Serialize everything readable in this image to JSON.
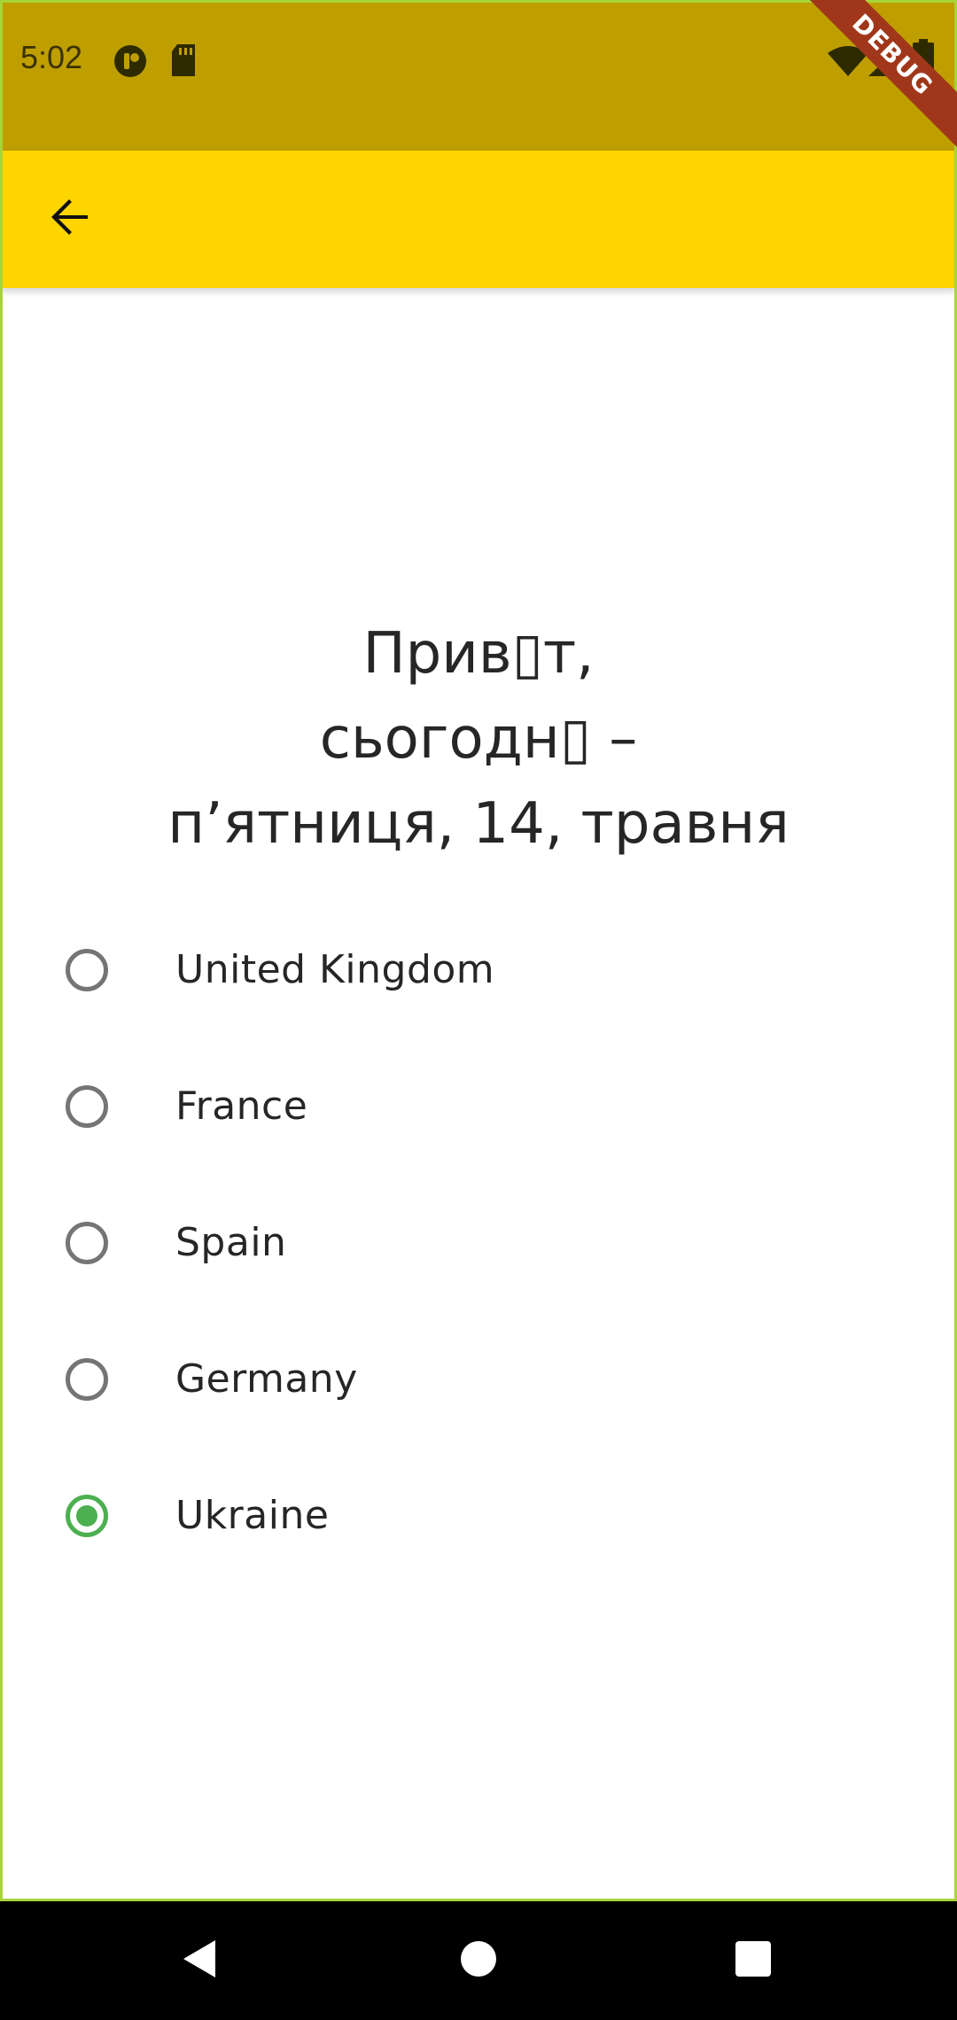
{
  "status_bar": {
    "time": "5:02",
    "icons_left": [
      "circle-app-icon",
      "sd-card-icon"
    ],
    "icons_right": [
      "wifi-icon",
      "signal-icon",
      "battery-icon"
    ],
    "debug_label": "DEBUG",
    "background": "#bf9f00"
  },
  "app_bar": {
    "background": "#ffd500",
    "back_icon": "arrow-left-icon"
  },
  "greeting": {
    "line1": "Прив▯т,",
    "line2": "сьогодн▯ –",
    "line3": "п’ятниця, 14, травня"
  },
  "countries": [
    {
      "label": "United Kingdom",
      "selected": false
    },
    {
      "label": "France",
      "selected": false
    },
    {
      "label": "Spain",
      "selected": false
    },
    {
      "label": "Germany",
      "selected": false
    },
    {
      "label": "Ukraine",
      "selected": true
    }
  ],
  "colors": {
    "accent_selected": "#4caf50",
    "radio_unselected": "#757575"
  },
  "nav_bar": {
    "buttons": [
      "back-triangle-icon",
      "home-circle-icon",
      "recents-square-icon"
    ]
  }
}
